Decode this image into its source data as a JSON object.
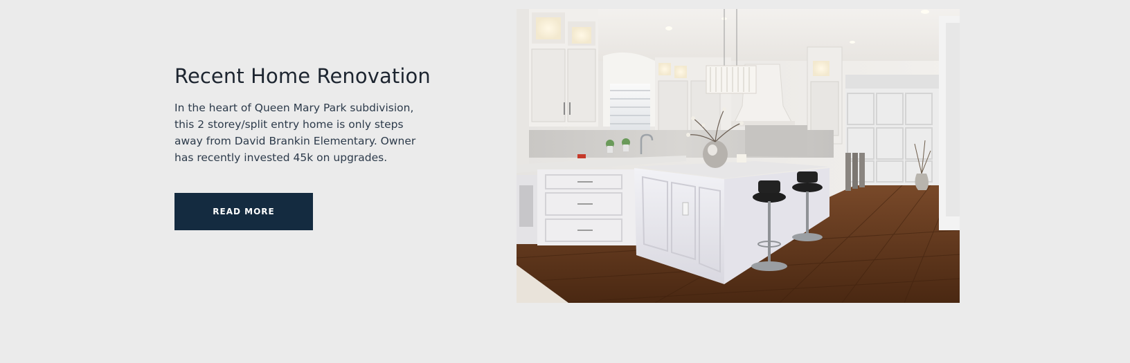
{
  "feature": {
    "title": "Recent Home Renovation",
    "description": "In the heart of Queen Mary Park subdivision, this 2 storey/split entry home is only steps away from David Brankin Elementary. Owner has recently invested 45k on upgrades.",
    "button_label": "READ MORE"
  },
  "image": {
    "alt": "kitchen-photo"
  },
  "colors": {
    "page_background": "#ebebeb",
    "title": "#1d2530",
    "body_text": "#2c3a4a",
    "button_background": "#142b40",
    "button_text": "#ffffff"
  }
}
